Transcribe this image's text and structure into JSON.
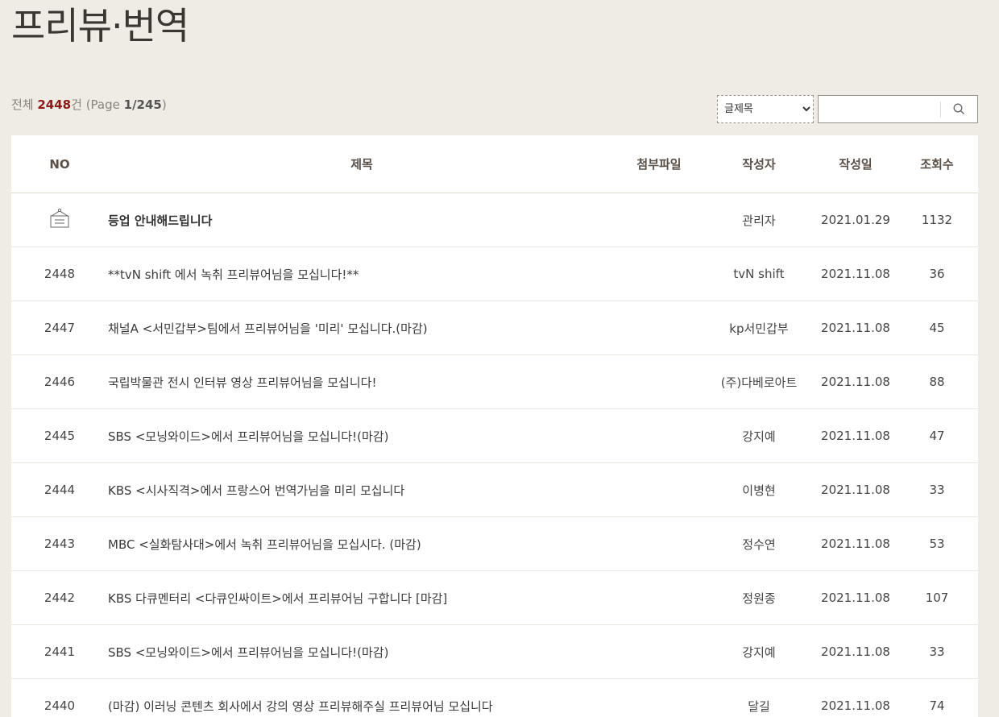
{
  "page_title": "프리뷰·번역",
  "summary": {
    "total_prefix": "전체 ",
    "total_count": "2448",
    "total_suffix": "건 (Page ",
    "page_value": "1/245",
    "page_suffix": ")"
  },
  "search": {
    "selected_option": "글제목",
    "options": [
      "글제목"
    ],
    "input_value": "",
    "icon": "search-icon"
  },
  "table": {
    "headers": {
      "no": "NO",
      "subject": "제목",
      "attachment": "첨부파일",
      "writer": "작성자",
      "date": "작성일",
      "views": "조회수"
    },
    "notice": {
      "icon": "notice-board-icon",
      "subject": "등업 안내해드립니다",
      "attachment": "",
      "writer": "관리자",
      "date": "2021.01.29",
      "views": "1132"
    },
    "rows": [
      {
        "no": "2448",
        "subject": "**tvN shift 에서 녹취 프리뷰어님을 모십니다!**",
        "attachment": "",
        "writer": "tvN shift",
        "date": "2021.11.08",
        "views": "36"
      },
      {
        "no": "2447",
        "subject": "채널A <서민갑부>팀에서 프리뷰어님을 '미리' 모십니다.(마감)",
        "attachment": "",
        "writer": "kp서민갑부",
        "date": "2021.11.08",
        "views": "45"
      },
      {
        "no": "2446",
        "subject": "국립박물관 전시 인터뷰 영상 프리뷰어님을 모십니다!",
        "attachment": "",
        "writer": "(주)다베로아트",
        "date": "2021.11.08",
        "views": "88"
      },
      {
        "no": "2445",
        "subject": "SBS <모닝와이드>에서 프리뷰어님을 모십니다!(마감)",
        "attachment": "",
        "writer": "강지예",
        "date": "2021.11.08",
        "views": "47"
      },
      {
        "no": "2444",
        "subject": "KBS <시사직격>에서 프랑스어 번역가님을 미리 모십니다",
        "attachment": "",
        "writer": "이병현",
        "date": "2021.11.08",
        "views": "33"
      },
      {
        "no": "2443",
        "subject": "MBC <실화탐사대>에서 녹취 프리뷰어님을 모십시다. (마감)",
        "attachment": "",
        "writer": "정수연",
        "date": "2021.11.08",
        "views": "53"
      },
      {
        "no": "2442",
        "subject": "KBS 다큐멘터리 <다큐인싸이트>에서 프리뷰어님 구합니다 [마감]",
        "attachment": "",
        "writer": "정원종",
        "date": "2021.11.08",
        "views": "107"
      },
      {
        "no": "2441",
        "subject": "SBS <모닝와이드>에서 프리뷰어님을 모십니다!(마감)",
        "attachment": "",
        "writer": "강지예",
        "date": "2021.11.08",
        "views": "33"
      },
      {
        "no": "2440",
        "subject": "(마감) 이러닝 콘텐츠 회사에서 강의 영상 프리뷰해주실 프리뷰어님 모십니다",
        "attachment": "",
        "writer": "달길",
        "date": "2021.11.08",
        "views": "74"
      }
    ]
  },
  "colors": {
    "background": "#efebe5",
    "count_accent": "#8b1a1a",
    "table_bg": "#ffffff"
  }
}
